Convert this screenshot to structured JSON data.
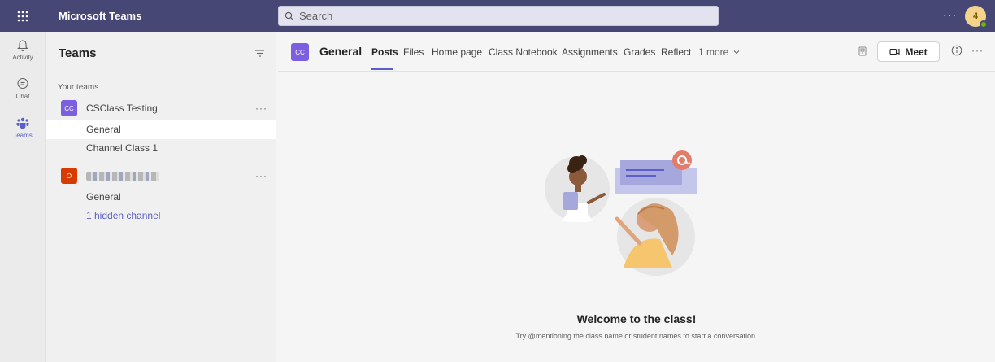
{
  "app": {
    "title": "Microsoft Teams",
    "search_placeholder": "Search",
    "more": "···",
    "avatar_initial": "4"
  },
  "rail": {
    "items": [
      {
        "label": "Activity",
        "icon": "bell-icon"
      },
      {
        "label": "Chat",
        "icon": "chat-icon"
      },
      {
        "label": "Teams",
        "icon": "teams-icon"
      }
    ]
  },
  "pane": {
    "title": "Teams",
    "section": "Your teams",
    "teams": [
      {
        "initials": "CC",
        "name": "CSClass Testing",
        "color": "#7b5fe0",
        "more": "···",
        "channels": [
          "General",
          "Channel Class 1"
        ]
      },
      {
        "initials": "O",
        "name": "",
        "color": "#d83b01",
        "more": "···",
        "channels": [
          "General",
          "1 hidden channel"
        ]
      }
    ]
  },
  "main": {
    "channel_initials": "CC",
    "channel_name": "General",
    "tabs": [
      "Posts",
      "Files",
      "Home page",
      "Class Notebook",
      "Assignments",
      "Grades",
      "Reflect",
      "1 more"
    ],
    "meet_label": "Meet",
    "more": "···",
    "welcome_title": "Welcome to the class!",
    "welcome_hint": "Try @mentioning the class name or student names to start a conversation."
  },
  "colors": {
    "topbar": "#464775",
    "accent": "#5b5fc7"
  }
}
